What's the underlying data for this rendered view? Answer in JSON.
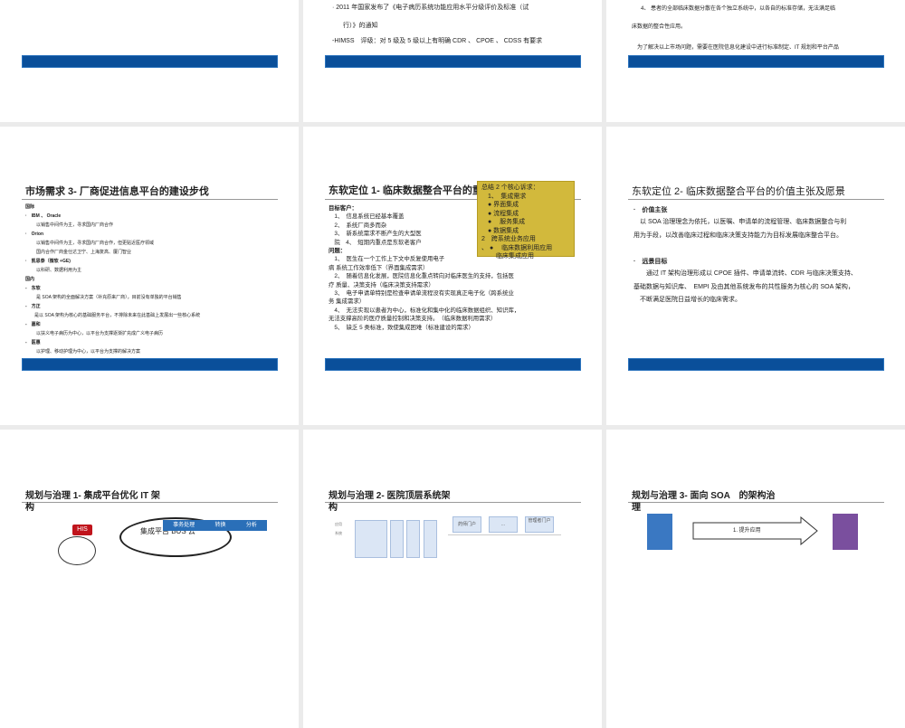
{
  "slides": [
    {
      "id": 1
    },
    {
      "id": 2,
      "lines": [
        "· 2011 年国家发布了《电子病历系统功能应用水平分级评价及标准（试",
        "行）》的通知",
        "-HIMSS　评级：对 5 级及 5 级以上有明确 CDR 、 CPOE 、 CDSS 有要求"
      ]
    },
    {
      "id": 3,
      "lines": [
        "4、 患者的全部临床数据分散在各个独立系统中，以各自的标准存储，无法满足临",
        "床数据的整合性应用。",
        "为了解决以上市场问题，需要在医院信息化建设中进行标准制定、IT 规划和平台产品"
      ]
    },
    {
      "id": 4,
      "title": "市场需求 3- 厂商促进信息平台的建设步伐",
      "lines": [
        "国际",
        "·　IBM 、 Oracle",
        "以销售中间件为主，寻求国内厂商合作",
        "·　Orion",
        "以销售中间件为主，寻求国内厂商合作，但更贴近医疗领域",
        "国内合作厂商金仕达卫宁、上海复高、厦门智业",
        "·　凯思泰（微软 +GE)",
        "以科研、数据利用为主",
        "国内",
        "-　东软",
        "是 SOA 架构的全面解决方案（补充原来厂商），目前没有单独的平台销售",
        "-　方正",
        "是以 SOA 架构为核心的基础服务平台，不排除未来在此基础上发展出一些核心系统",
        "-　嘉和",
        "以扶义电子病历为中心，以平台为支撑逐渐扩充成广义电子病历",
        "-　医惠",
        "以护理、移动护理为中心，以平台为支撑的解决方案"
      ]
    },
    {
      "id": 5,
      "title": "东软定位 1- 临床数据整合平台的重",
      "callout": [
        "总结 2 个核心诉求：",
        "　1、　集成需求",
        "　● 界面集成",
        "　● 流程集成",
        "　●　 服务集成",
        "　● 数据集成",
        "2　跨系统业务应用",
        "、 ●　 临床数据利用应用",
        "　　 临床集成应用"
      ],
      "lines": [
        "目标客户：",
        "　1、　信息系统已经基本覆盖",
        "　2、　系统厂商多而杂",
        "　3、　新系统需求不断产生的大型医",
        "　院　4、　短期内重点是东软老客户",
        "问题：",
        "　1、　医生在一个工作上下文中反复使用电子",
        "病 系统工作效率低下（界面集成需求）",
        "　2、　随着信息化发展，医院信息化重点转向对临床医生的支持，包括医",
        "疗 质量、决策支持（临床决策支持需求）",
        "　3、　电子申请单特别是检查申请单流程没有实现真正电子化（跨系统业",
        "务 集成需求）",
        "　4、　无法实现以患者为中心，标准化和集中化的临床数据组织、知识库，",
        "无法支撑高阶的医疗质量控制和决策支持。　（临床数据利用需求）",
        "　5、　缺乏 5 类标准，致使集成困难（标准建设的需求）"
      ]
    },
    {
      "id": 6,
      "title": "东软定位 2- 临床数据整合平台的价值主张及愿景",
      "lines": [
        "·　价值主张",
        "　以 SOA 治理理念为依托，以医嘱、申请单的流程管理、临床数据整合与利",
        "用为手段，以改善临床过程和临床决策支持能力为目标发展临床整合平台。",
        "·　远景目标",
        "　　通过 IT 架构治理形成以 CPOE 插件、申请单流转、CDR 与临床决策支持、",
        "基础数据与知识库、　EMPI 及由其他系统发布的共性服务为核心的 SOA 架构，",
        "　不断满足医院日益增长的临床需求。"
      ]
    },
    {
      "id": 7,
      "title": "规划与治理 1- 集成平台优化 IT 架",
      "title2": "构",
      "his": "HIS",
      "cloud": "集成平台 BUS 云",
      "bus": [
        "事务处理",
        "转换",
        "分析"
      ]
    },
    {
      "id": 8,
      "title": "规划与治理 2- 医院顶层系统架",
      "title2": "构",
      "side": "应用系统",
      "portals": [
        "药师门户",
        "...",
        "管理者门户"
      ]
    },
    {
      "id": 9,
      "title": "规划与治理 3- 面向 SOA　的架构治",
      "title2": "理",
      "arrow": "1. 提升应用"
    }
  ],
  "colors": {
    "bar": "#0a4f9a",
    "callout": "#d2b93c",
    "blue": "#3a78c2",
    "purple": "#7a4f9e"
  }
}
